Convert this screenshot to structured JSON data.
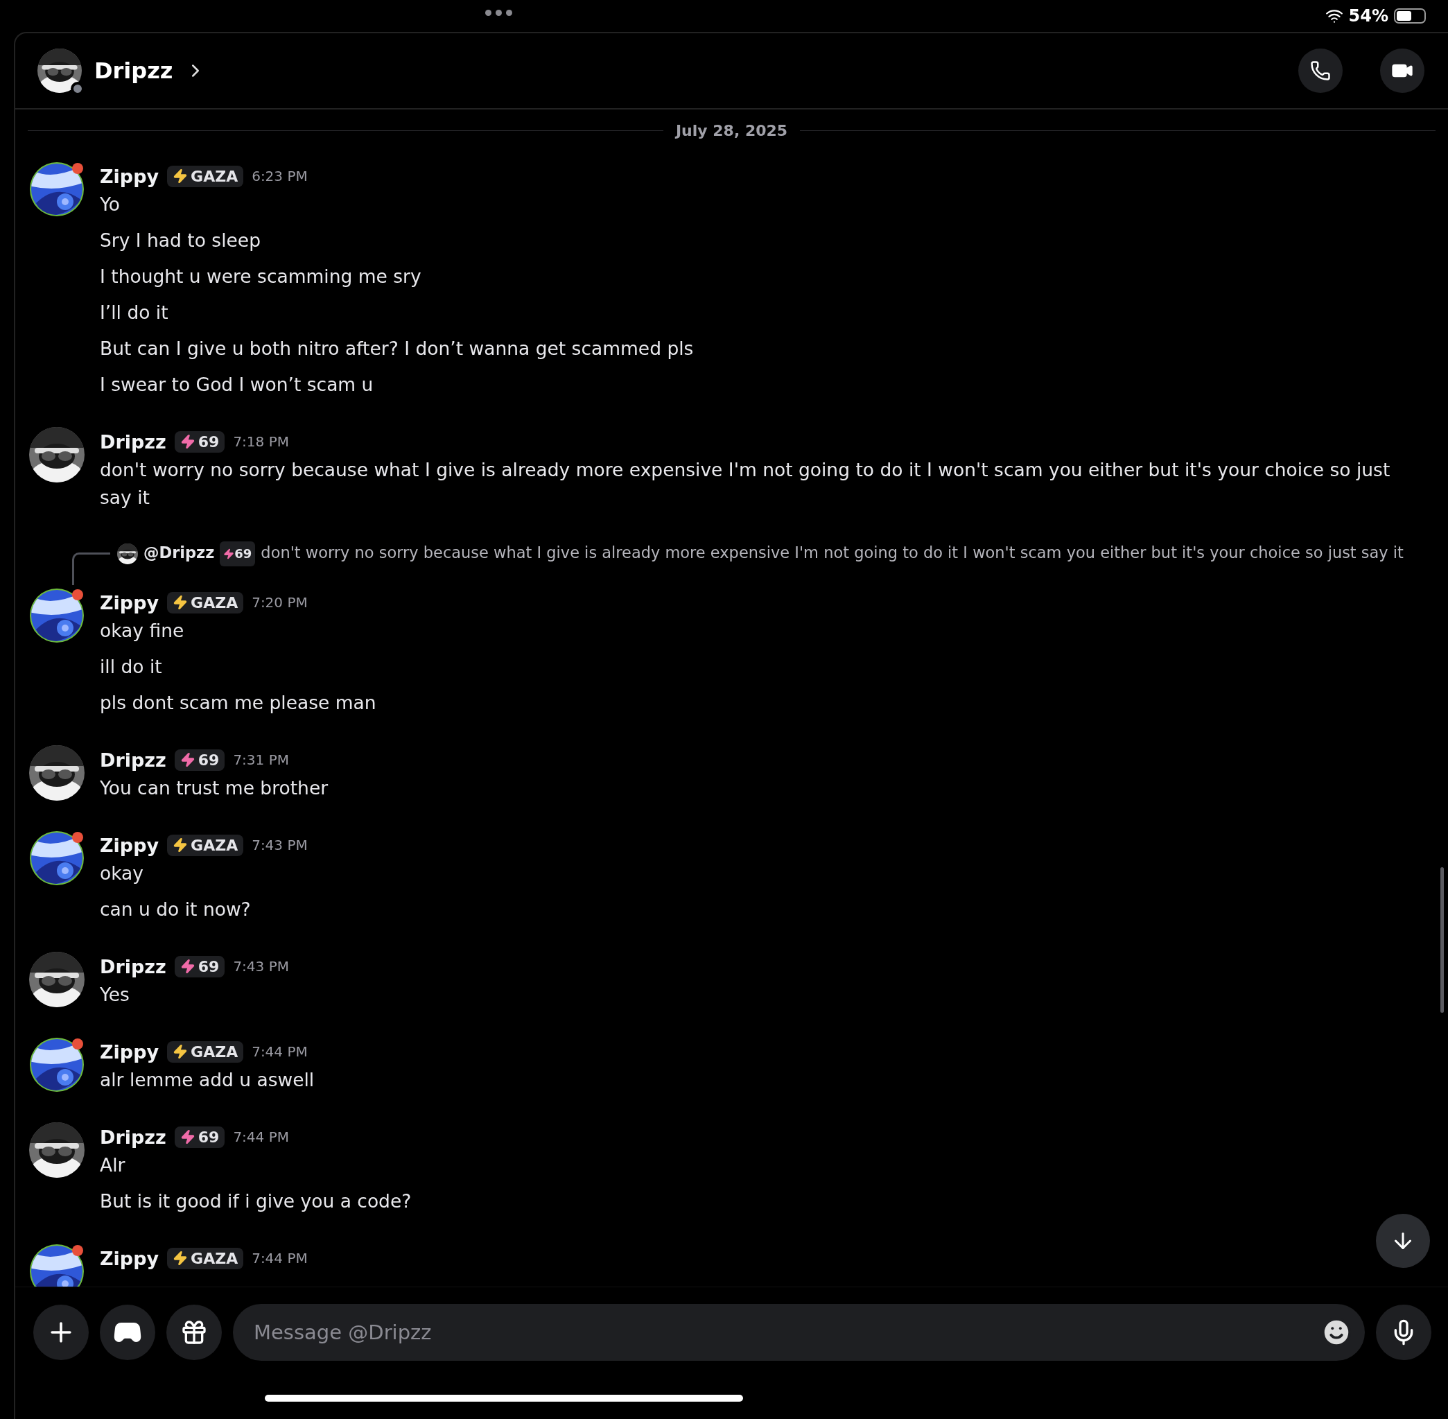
{
  "status_bar": {
    "battery": "54%"
  },
  "header": {
    "name": "Dripzz",
    "online": false
  },
  "date_divider": "July 28, 2025",
  "messages": [
    {
      "author": "Zippy",
      "badge": {
        "text": "GAZA",
        "color": "#f5c542"
      },
      "time": "6:23 PM",
      "lines": [
        "Yo",
        "Sry I had to sleep",
        "I thought u were scamming me sry",
        "I’ll do it",
        "But can I give u both nitro after? I don’t wanna get scammed pls",
        "I swear to God I won’t scam u"
      ]
    },
    {
      "author": "Dripzz",
      "badge": {
        "text": "69",
        "color": "#f06ba8"
      },
      "time": "7:18 PM",
      "lines": [
        "don't worry no sorry because what I give is already more expensive I'm not going to do it I won't scam you either but it's your choice so just say it"
      ]
    },
    {
      "author": "Zippy",
      "badge": {
        "text": "GAZA",
        "color": "#f5c542"
      },
      "time": "7:20 PM",
      "reply": {
        "author": "@Dripzz",
        "badge": {
          "text": "69",
          "color": "#f06ba8"
        },
        "text": "don't worry no sorry because what I give is already more expensive I'm not going to do it I won't scam you either but it's your choice so just say it"
      },
      "lines": [
        "okay fine",
        "ill do it",
        "pls dont scam me please man"
      ]
    },
    {
      "author": "Dripzz",
      "badge": {
        "text": "69",
        "color": "#f06ba8"
      },
      "time": "7:31 PM",
      "lines": [
        "You can trust me brother"
      ]
    },
    {
      "author": "Zippy",
      "badge": {
        "text": "GAZA",
        "color": "#f5c542"
      },
      "time": "7:43 PM",
      "lines": [
        "okay",
        "can u do it now?"
      ]
    },
    {
      "author": "Dripzz",
      "badge": {
        "text": "69",
        "color": "#f06ba8"
      },
      "time": "7:43 PM",
      "lines": [
        "Yes"
      ]
    },
    {
      "author": "Zippy",
      "badge": {
        "text": "GAZA",
        "color": "#f5c542"
      },
      "time": "7:44 PM",
      "lines": [
        "alr lemme add u aswell"
      ]
    },
    {
      "author": "Dripzz",
      "badge": {
        "text": "69",
        "color": "#f06ba8"
      },
      "time": "7:44 PM",
      "lines": [
        "Alr",
        "But is it good if i give you a code?"
      ]
    },
    {
      "author": "Zippy",
      "badge": {
        "text": "GAZA",
        "color": "#f5c542"
      },
      "time": "7:44 PM"
    }
  ],
  "composer": {
    "placeholder": "Message @Dripzz"
  }
}
